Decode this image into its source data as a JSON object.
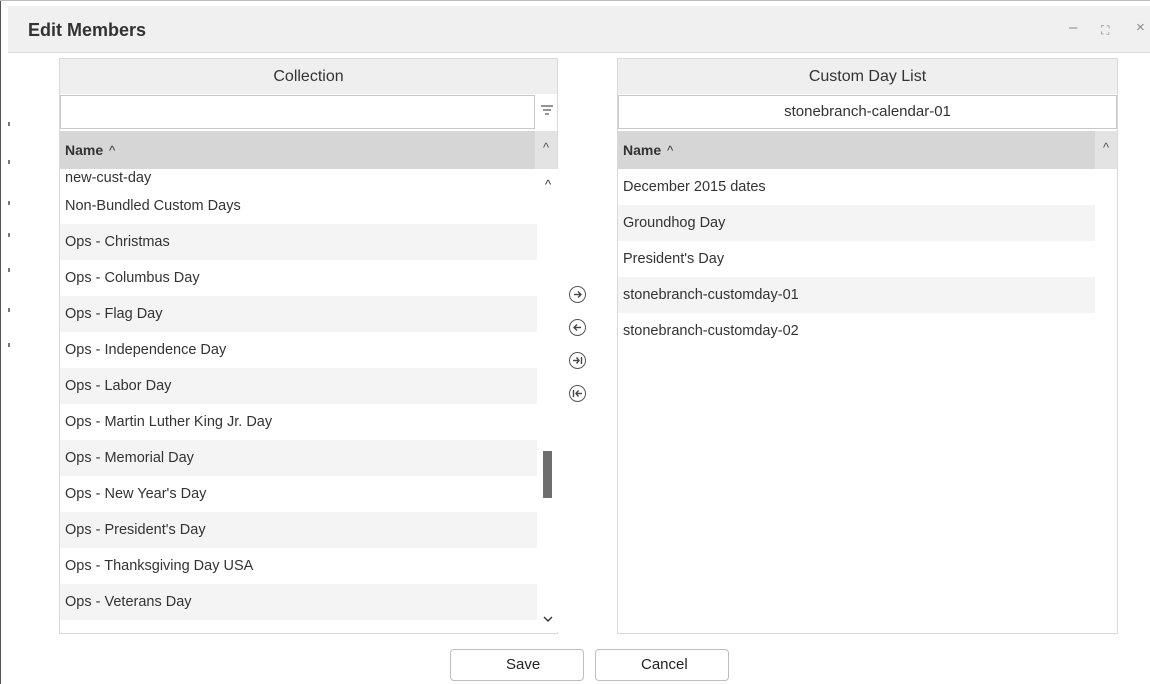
{
  "window": {
    "title": "Edit Members",
    "controls": {
      "minimize": "–",
      "maximize": "⛶",
      "close": "×"
    }
  },
  "collection": {
    "header": "Collection",
    "filter_value": "",
    "column_name": "Name",
    "sort_indicator": "^",
    "items": [
      "new-cust-day",
      "Non-Bundled Custom Days",
      "Ops - Christmas",
      "Ops - Columbus Day",
      "Ops - Flag Day",
      "Ops - Independence Day",
      "Ops - Labor Day",
      "Ops - Martin Luther King Jr. Day",
      "Ops - Memorial Day",
      "Ops - New Year's Day",
      "Ops - President's Day",
      "Ops - Thanksgiving Day USA",
      "Ops - Veterans Day"
    ]
  },
  "custom_day_list": {
    "header": "Custom Day List",
    "calendar": "stonebranch-calendar-01",
    "column_name": "Name",
    "sort_indicator": "^",
    "items": [
      "December 2015 dates",
      "Groundhog Day",
      "President's Day",
      "stonebranch-customday-01",
      "stonebranch-customday-02"
    ]
  },
  "transfer_icons": [
    "arrow-right-icon",
    "arrow-left-icon",
    "move-all-right-icon",
    "move-all-left-icon"
  ],
  "buttons": {
    "save": "Save",
    "cancel": "Cancel"
  }
}
